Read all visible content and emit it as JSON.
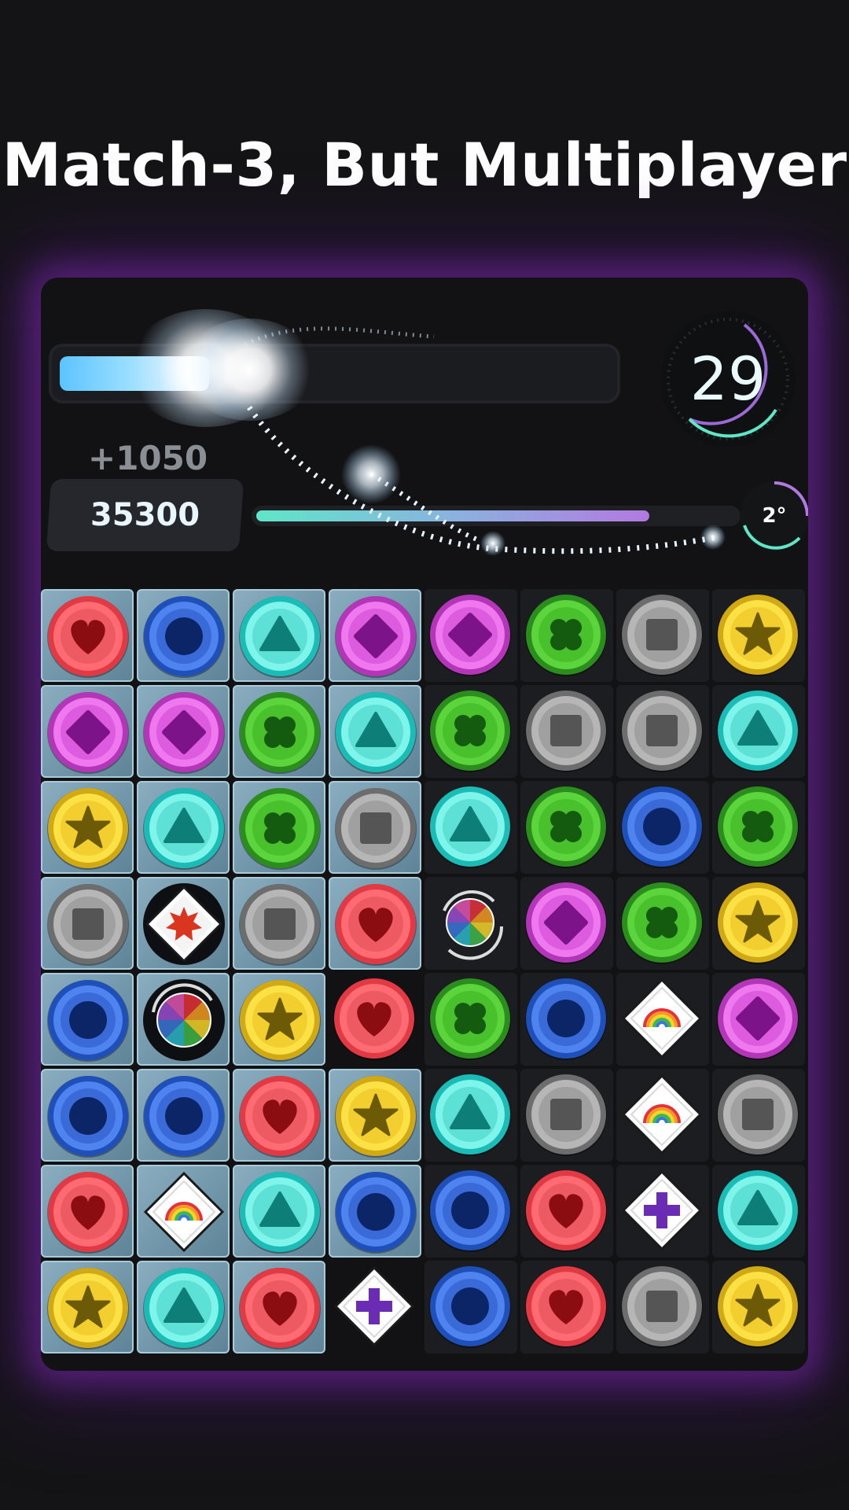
{
  "headline": "Match-3, But Multiplayer",
  "hud": {
    "timer": "29",
    "score_gain": "+1050",
    "score": "35300",
    "level": "2°",
    "progress_fraction": 0.27,
    "level_fraction": 0.82
  },
  "colors": {
    "accent_glow": "#7a2ab0",
    "progress": "#5cc4ff",
    "timer_ring": "#5fe6c8",
    "level_ring": "#b279e0"
  },
  "board": {
    "columns": 8,
    "rows": 8,
    "owner_rows": [
      "11112222",
      "11112222",
      "11112222",
      "11112222",
      "11102222",
      "11112222",
      "11112222",
      "11102222"
    ],
    "tiles": [
      [
        "heart",
        "circle",
        "triangle",
        "diamond",
        "diamond",
        "clover",
        "square",
        "star"
      ],
      [
        "diamond",
        "diamond",
        "clover",
        "triangle",
        "clover",
        "square",
        "square",
        "triangle"
      ],
      [
        "star",
        "triangle",
        "clover",
        "square",
        "triangle",
        "clover",
        "circle",
        "clover"
      ],
      [
        "square",
        "bomb",
        "square",
        "heart",
        "rainbow-ring",
        "diamond",
        "clover",
        "star"
      ],
      [
        "circle",
        "color-wheel",
        "star",
        "heart",
        "clover",
        "circle",
        "rainbow-diamond",
        "diamond"
      ],
      [
        "circle",
        "circle",
        "heart",
        "star",
        "triangle",
        "square",
        "rainbow-diamond",
        "square"
      ],
      [
        "heart",
        "rainbow-diamond",
        "triangle",
        "circle",
        "circle",
        "heart",
        "plus-diamond",
        "triangle"
      ],
      [
        "star",
        "triangle",
        "heart",
        "plus-diamond",
        "circle",
        "heart",
        "square",
        "star"
      ]
    ]
  }
}
